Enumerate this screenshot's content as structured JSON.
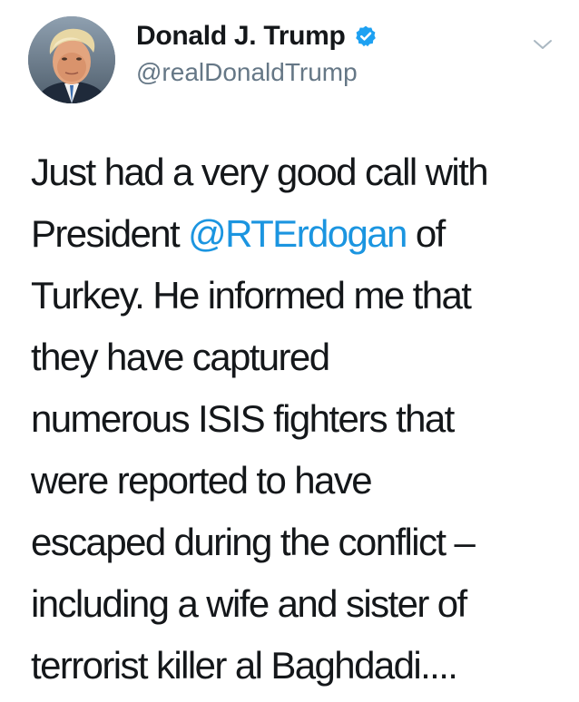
{
  "user": {
    "display_name": "Donald J. Trump",
    "handle": "@realDonaldTrump",
    "verified": true,
    "verified_icon": "verified-badge-icon",
    "avatar_icon": "avatar-image"
  },
  "menu": {
    "icon": "chevron-down-icon"
  },
  "tweet": {
    "lines": [
      {
        "before": "Just had a very good call with",
        "mention": "",
        "after": ""
      },
      {
        "before": "President ",
        "mention": "@RTErdogan",
        "after": " of"
      },
      {
        "before": "Turkey. He informed me that",
        "mention": "",
        "after": ""
      },
      {
        "before": "they have captured",
        "mention": "",
        "after": ""
      },
      {
        "before": "numerous ISIS fighters that",
        "mention": "",
        "after": ""
      },
      {
        "before": "were reported to have",
        "mention": "",
        "after": ""
      },
      {
        "before": "escaped during the conflict –",
        "mention": "",
        "after": ""
      },
      {
        "before": "including a wife and sister of",
        "mention": "",
        "after": ""
      },
      {
        "before": "terrorist killer al Baghdadi....",
        "mention": "",
        "after": ""
      }
    ]
  },
  "colors": {
    "text": "#14171a",
    "secondary": "#657786",
    "link": "#1b95e0",
    "verified": "#1da1f2"
  }
}
